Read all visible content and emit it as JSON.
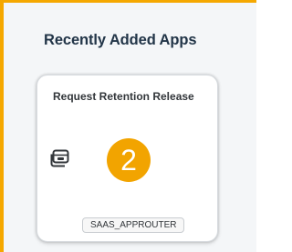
{
  "section": {
    "title": "Recently Added Apps"
  },
  "tile": {
    "title": "Request Retention Release",
    "icon": "app-window-icon",
    "step_badge": "2",
    "footer_tag": "SAAS_APPROUTER"
  },
  "colors": {
    "highlight_border": "#f5a800",
    "badge": "#f2a400",
    "title_text": "#223548"
  }
}
